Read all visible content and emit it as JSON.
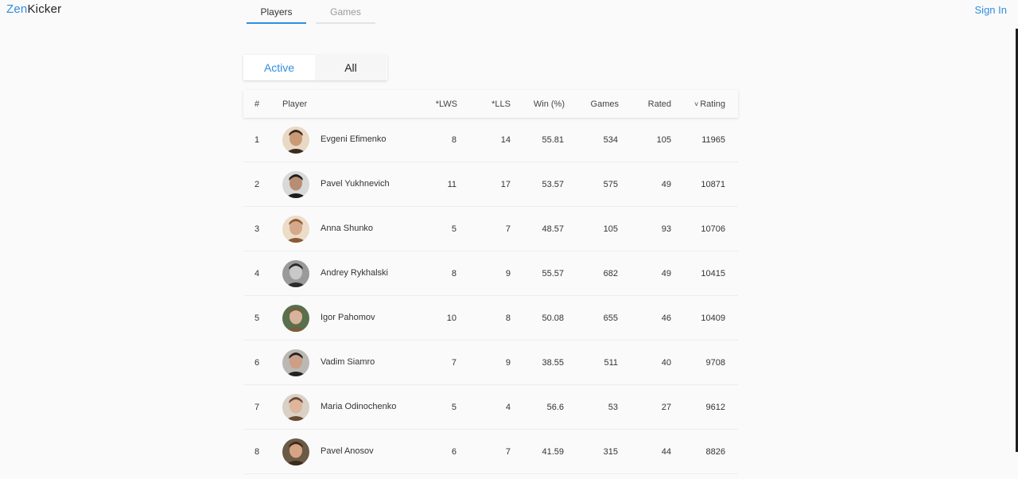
{
  "logo": {
    "part1": "Zen",
    "part2": "Kicker"
  },
  "header": {
    "signin": "Sign In"
  },
  "tabs": [
    {
      "label": "Players"
    },
    {
      "label": "Games"
    }
  ],
  "filter": {
    "active": "Active",
    "all": "All"
  },
  "table": {
    "columns": {
      "rank": "#",
      "player": "Player",
      "lws": "*LWS",
      "lls": "*LLS",
      "win": "Win (%)",
      "games": "Games",
      "rated": "Rated",
      "rating": "Rating"
    },
    "sort_indicator": "˅",
    "rows": [
      {
        "rank": "1",
        "name": "Evgeni Efimenko",
        "lws": "8",
        "lls": "14",
        "win": "55.81",
        "games": "534",
        "rated": "105",
        "rating": "11965"
      },
      {
        "rank": "2",
        "name": "Pavel Yukhnevich",
        "lws": "11",
        "lls": "17",
        "win": "53.57",
        "games": "575",
        "rated": "49",
        "rating": "10871"
      },
      {
        "rank": "3",
        "name": "Anna Shunko",
        "lws": "5",
        "lls": "7",
        "win": "48.57",
        "games": "105",
        "rated": "93",
        "rating": "10706"
      },
      {
        "rank": "4",
        "name": "Andrey Rykhalski",
        "lws": "8",
        "lls": "9",
        "win": "55.57",
        "games": "682",
        "rated": "49",
        "rating": "10415"
      },
      {
        "rank": "5",
        "name": "Igor Pahomov",
        "lws": "10",
        "lls": "8",
        "win": "50.08",
        "games": "655",
        "rated": "46",
        "rating": "10409"
      },
      {
        "rank": "6",
        "name": "Vadim Siamro",
        "lws": "7",
        "lls": "9",
        "win": "38.55",
        "games": "511",
        "rated": "40",
        "rating": "9708"
      },
      {
        "rank": "7",
        "name": "Maria Odinochenko",
        "lws": "5",
        "lls": "4",
        "win": "56.6",
        "games": "53",
        "rated": "27",
        "rating": "9612"
      },
      {
        "rank": "8",
        "name": "Pavel Anosov",
        "lws": "6",
        "lls": "7",
        "win": "41.59",
        "games": "315",
        "rated": "44",
        "rating": "8826"
      }
    ]
  },
  "colors": {
    "accent": "#2f8ee0"
  }
}
